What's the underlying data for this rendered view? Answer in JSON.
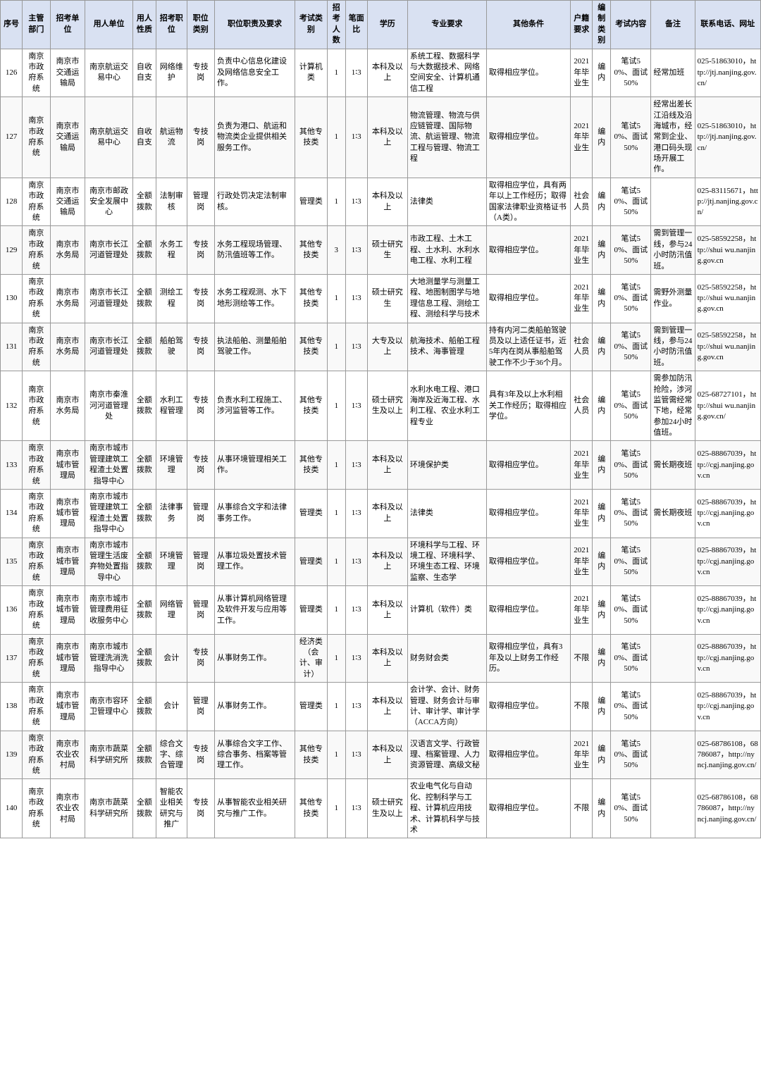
{
  "headers": [
    "序号",
    "主管部门",
    "招考单位",
    "用人单位",
    "用人性质",
    "招考职位",
    "职位类别",
    "职位职责及要求",
    "考试类别",
    "招考人数",
    "笔面比",
    "学历",
    "专业要求",
    "其他条件",
    "户籍要求",
    "编制类别",
    "考试内容",
    "备注",
    "联系电话、网址"
  ],
  "rows": [
    {
      "no": "126",
      "sys": "南京市政府系统",
      "dept": "南京市交通运输局",
      "unit": "南京航运交易中心",
      "nature": "自收自支",
      "pos": "网络维护",
      "cat": "专技岗",
      "duty": "负责中心信息化建设及网络信息安全工作。",
      "exam": "计算机类",
      "num": "1",
      "ratio": "1∶3",
      "edu": "本科及以上",
      "major": "系统工程、数据科学与大数据技术、网络空间安全、计算机通信工程",
      "other": "取得相应学位。",
      "huji": "2021年毕业生",
      "bianzhi": "编内",
      "exam2": "笔试50%、面试50%",
      "note": "经常加班",
      "contact": "025-51863010，http://jtj.nanjing.gov.cn/"
    },
    {
      "no": "127",
      "sys": "南京市政府系统",
      "dept": "南京市交通运输局",
      "unit": "南京航运交易中心",
      "nature": "自收自支",
      "pos": "航运物流",
      "cat": "专技岗",
      "duty": "负责为港口、航运和物流类企业提供相关服务工作。",
      "exam": "其他专技类",
      "num": "1",
      "ratio": "1∶3",
      "edu": "本科及以上",
      "major": "物流管理、物流与供应链管理、国际物流、航运管理、物流工程与管理、物流工程",
      "other": "取得相应学位。",
      "huji": "2021年毕业生",
      "bianzhi": "编内",
      "exam2": "笔试50%、面试50%",
      "note": "经常出差长江沿线及沿海城市，经常到企业、港口码头现场开展工作。",
      "contact": "025-51863010，http://jtj.nanjing.gov.cn/"
    },
    {
      "no": "128",
      "sys": "南京市政府系统",
      "dept": "南京市交通运输局",
      "unit": "南京市邮政安全发展中心",
      "nature": "全额拨款",
      "pos": "法制审核",
      "cat": "管理岗",
      "duty": "行政处罚决定法制审核。",
      "exam": "管理类",
      "num": "1",
      "ratio": "1∶3",
      "edu": "本科及以上",
      "major": "法律类",
      "other": "取得相应学位，具有两年以上工作经历；取得国家法律职业资格证书（A类）。",
      "huji": "社会人员",
      "bianzhi": "编内",
      "exam2": "笔试50%、面试50%",
      "note": "",
      "contact": "025-83115671，http://jtj.nanjing.gov.cn/"
    },
    {
      "no": "129",
      "sys": "南京市政府系统",
      "dept": "南京市水务局",
      "unit": "南京市长江河道管理处",
      "nature": "全额拨款",
      "pos": "水务工程",
      "cat": "专技岗",
      "duty": "水务工程现场管理、防汛值班等工作。",
      "exam": "其他专技类",
      "num": "3",
      "ratio": "1∶3",
      "edu": "硕士研究生",
      "major": "市政工程、土木工程、土水利、水利水电工程、水利工程",
      "other": "取得相应学位。",
      "huji": "2021年毕业生",
      "bianzhi": "编内",
      "exam2": "笔试50%、面试50%",
      "note": "需到管理一线，参与24小时防汛值班。",
      "contact": "025-58592258，http://shui wu.nanjing.gov.cn"
    },
    {
      "no": "130",
      "sys": "南京市政府系统",
      "dept": "南京市水务局",
      "unit": "南京市长江河道管理处",
      "nature": "全额拨款",
      "pos": "测绘工程",
      "cat": "专技岗",
      "duty": "水务工程观测、水下地形测绘等工作。",
      "exam": "其他专技类",
      "num": "1",
      "ratio": "1∶3",
      "edu": "硕士研究生",
      "major": "大地测量学与测量工程、地图制图学与地理信息工程、测绘工程、测绘科学与技术",
      "other": "取得相应学位。",
      "huji": "2021年毕业生",
      "bianzhi": "编内",
      "exam2": "笔试50%、面试50%",
      "note": "需野外测量作业。",
      "contact": "025-58592258，http://shui wu.nanjing.gov.cn"
    },
    {
      "no": "131",
      "sys": "南京市政府系统",
      "dept": "南京市水务局",
      "unit": "南京市长江河道管理处",
      "nature": "全额拨款",
      "pos": "船舶驾驶",
      "cat": "专技岗",
      "duty": "执法船舶、测量船舶驾驶工作。",
      "exam": "其他专技类",
      "num": "1",
      "ratio": "1∶3",
      "edu": "大专及以上",
      "major": "航海技术、船舶工程技术、海事管理",
      "other": "持有内河二类船舶驾驶员及以上适任证书，近5年内在岗从事船舶驾驶工作不少于36个月。",
      "huji": "社会人员",
      "bianzhi": "编内",
      "exam2": "笔试50%、面试50%",
      "note": "需到管理一线，参与24小时防汛值班。",
      "contact": "025-58592258，http://shui wu.nanjing.gov.cn"
    },
    {
      "no": "132",
      "sys": "南京市政府系统",
      "dept": "南京市水务局",
      "unit": "南京市秦淮河河道管理处",
      "nature": "全额拨款",
      "pos": "水利工程管理",
      "cat": "专技岗",
      "duty": "负责水利工程施工、涉河监管等工作。",
      "exam": "其他专技类",
      "num": "1",
      "ratio": "1∶3",
      "edu": "硕士研究生及以上",
      "major": "水利水电工程、港口海岸及近海工程、水利工程、农业水利工程专业",
      "other": "具有3年及以上水利相关工作经历；取得相应学位。",
      "huji": "社会人员",
      "bianzhi": "编内",
      "exam2": "笔试50%、面试50%",
      "note": "需参加防汛抢险，涉河监管需经常下地，经常参加24小时值班。",
      "contact": "025-68727101，http://shui wu.nanjing.gov.cn/"
    },
    {
      "no": "133",
      "sys": "南京市政府系统",
      "dept": "南京市城市管理局",
      "unit": "南京市城市管理建筑工程渣土处置指导中心",
      "nature": "全额拨款",
      "pos": "环境管理",
      "cat": "专技岗",
      "duty": "从事环境管理相关工作。",
      "exam": "其他专技类",
      "num": "1",
      "ratio": "1∶3",
      "edu": "本科及以上",
      "major": "环境保护类",
      "other": "取得相应学位。",
      "huji": "2021年毕业生",
      "bianzhi": "编内",
      "exam2": "笔试50%、面试50%",
      "note": "需长期夜班",
      "contact": "025-88867039，http://cgj.nanjing.gov.cn"
    },
    {
      "no": "134",
      "sys": "南京市政府系统",
      "dept": "南京市城市管理局",
      "unit": "南京市城市管理建筑工程渣土处置指导中心",
      "nature": "全额拨款",
      "pos": "法律事务",
      "cat": "管理岗",
      "duty": "从事综合文字和法律事务工作。",
      "exam": "管理类",
      "num": "1",
      "ratio": "1∶3",
      "edu": "本科及以上",
      "major": "法律类",
      "other": "取得相应学位。",
      "huji": "2021年毕业生",
      "bianzhi": "编内",
      "exam2": "笔试50%、面试50%",
      "note": "需长期夜班",
      "contact": "025-88867039，http://cgj.nanjing.gov.cn"
    },
    {
      "no": "135",
      "sys": "南京市政府系统",
      "dept": "南京市城市管理局",
      "unit": "南京市城市管理生活废弃物处置指导中心",
      "nature": "全额拨款",
      "pos": "环境管理",
      "cat": "管理岗",
      "duty": "从事垃圾处置技术管理工作。",
      "exam": "管理类",
      "num": "1",
      "ratio": "1∶3",
      "edu": "本科及以上",
      "major": "环境科学与工程、环境工程、环境科学、环境生态工程、环境监察、生态学",
      "other": "取得相应学位。",
      "huji": "2021年毕业生",
      "bianzhi": "编内",
      "exam2": "笔试50%、面试50%",
      "note": "",
      "contact": "025-88867039，http://cgj.nanjing.gov.cn"
    },
    {
      "no": "136",
      "sys": "南京市政府系统",
      "dept": "南京市城市管理局",
      "unit": "南京市城市管理费用征收服务中心",
      "nature": "全额拨款",
      "pos": "网络管理",
      "cat": "管理岗",
      "duty": "从事计算机网络管理及软件开发与应用等工作。",
      "exam": "管理类",
      "num": "1",
      "ratio": "1∶3",
      "edu": "本科及以上",
      "major": "计算机（软件）类",
      "other": "取得相应学位。",
      "huji": "2021年毕业生",
      "bianzhi": "编内",
      "exam2": "笔试50%、面试50%",
      "note": "",
      "contact": "025-88867039，http://cgj.nanjing.gov.cn"
    },
    {
      "no": "137",
      "sys": "南京市政府系统",
      "dept": "南京市城市管理局",
      "unit": "南京市城市管理洗消洗指导中心",
      "nature": "全额拨款",
      "pos": "会计",
      "cat": "专技岗",
      "duty": "从事财务工作。",
      "exam": "经济类（会计、审计）",
      "num": "1",
      "ratio": "1∶3",
      "edu": "本科及以上",
      "major": "财务财会类",
      "other": "取得相应学位，具有3年及以上财务工作经历。",
      "huji": "不限",
      "bianzhi": "编内",
      "exam2": "笔试50%、面试50%",
      "note": "",
      "contact": "025-88867039，http://cgj.nanjing.gov.cn"
    },
    {
      "no": "138",
      "sys": "南京市政府系统",
      "dept": "南京市城市管理局",
      "unit": "南京市容环卫管理中心",
      "nature": "全额拨款",
      "pos": "会计",
      "cat": "管理岗",
      "duty": "从事财务工作。",
      "exam": "管理类",
      "num": "1",
      "ratio": "1∶3",
      "edu": "本科及以上",
      "major": "会计学、会计、财务管理、财务会计与审计、审计学、审计学（ACCA方向）",
      "other": "取得相应学位。",
      "huji": "不限",
      "bianzhi": "编内",
      "exam2": "笔试50%、面试50%",
      "note": "",
      "contact": "025-88867039，http://cgj.nanjing.gov.cn"
    },
    {
      "no": "139",
      "sys": "南京市政府系统",
      "dept": "南京市农业农村局",
      "unit": "南京市蔬菜科学研究所",
      "nature": "全额拨款",
      "pos": "综合文字、综合管理",
      "cat": "专技岗",
      "duty": "从事综合文字工作、综合事务、档案等管理工作。",
      "exam": "其他专技类",
      "num": "1",
      "ratio": "1∶3",
      "edu": "本科及以上",
      "major": "汉语言文学、行政管理、档案管理、人力资源管理、高级文秘",
      "other": "取得相应学位。",
      "huji": "2021年毕业生",
      "bianzhi": "编内",
      "exam2": "笔试50%、面试50%",
      "note": "",
      "contact": "025-68786108，68786087，http://nyncj.nanjing.gov.cn/"
    },
    {
      "no": "140",
      "sys": "南京市政府系统",
      "dept": "南京市农业农村局",
      "unit": "南京市蔬菜科学研究所",
      "nature": "全额拨款",
      "pos": "智能农业相关研究与推广",
      "cat": "专技岗",
      "duty": "从事智能农业相关研究与推广工作。",
      "exam": "其他专技类",
      "num": "1",
      "ratio": "1∶3",
      "edu": "硕士研究生及以上",
      "major": "农业电气化与自动化、控制科学与工程、计算机应用技术、计算机科学与技术",
      "other": "取得相应学位。",
      "huji": "不限",
      "bianzhi": "编内",
      "exam2": "笔试50%、面试50%",
      "note": "",
      "contact": "025-68786108，68786087，http://nyncj.nanjing.gov.cn/"
    }
  ]
}
